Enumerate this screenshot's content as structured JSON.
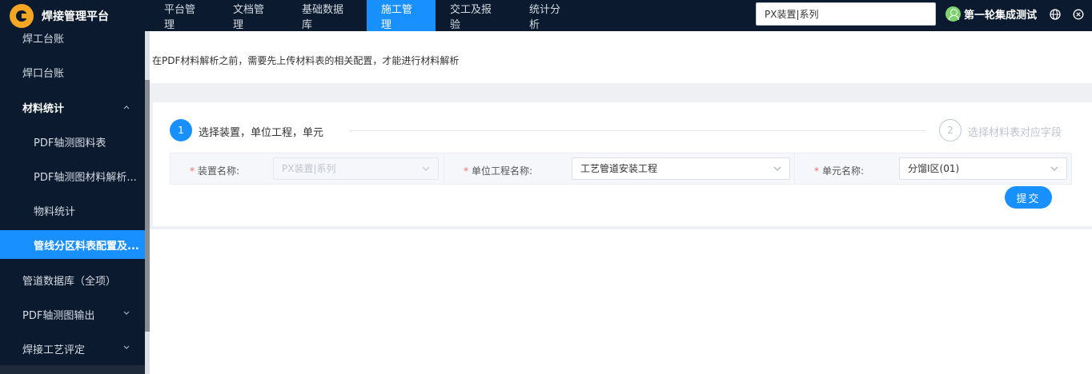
{
  "app": {
    "title": "焊接管理平台"
  },
  "nav": {
    "items": [
      {
        "label": "平台管理"
      },
      {
        "label": "文档管理"
      },
      {
        "label": "基础数据库"
      },
      {
        "label": "施工管理"
      },
      {
        "label": "交工及报验"
      },
      {
        "label": "统计分析"
      }
    ],
    "active_index": 3
  },
  "header": {
    "search_value": "PX装置|系列",
    "user_name": "第一轮集成测试",
    "icons": [
      "user-avatar-icon",
      "globe-icon",
      "logout-icon"
    ]
  },
  "sidebar": {
    "items": [
      {
        "label": "焊工台账"
      },
      {
        "label": "焊口台账"
      },
      {
        "label": "材料统计"
      },
      {
        "label": "PDF轴测图料表"
      },
      {
        "label": "PDF轴测图材料解析..."
      },
      {
        "label": "物料统计"
      },
      {
        "label": "管线分区料表配置及..."
      },
      {
        "label": "管道数据库（全项）"
      },
      {
        "label": "PDF轴测图输出"
      },
      {
        "label": "焊接工艺评定"
      }
    ],
    "active_index": 6
  },
  "main": {
    "notice": "在PDF材料解析之前，需要先上传材料表的相关配置，才能进行材料解析",
    "steps": [
      {
        "number": "1",
        "label": "选择装置，单位工程，单元",
        "status": "active"
      },
      {
        "number": "2",
        "label": "选择材料表对应字段",
        "status": "pending"
      }
    ],
    "form": {
      "device": {
        "label": "装置名称:",
        "value": "PX装置|系列",
        "disabled": true
      },
      "unit_project": {
        "label": "单位工程名称:",
        "value": "工艺管道安装工程"
      },
      "unit": {
        "label": "单元名称:",
        "value": "分馏Ⅰ区(01)"
      }
    },
    "submit_label": "提交"
  },
  "colors": {
    "primary": "#1890ff",
    "nav_bg": "#0b1a2e",
    "required": "#f56c6c",
    "logo": "#f5a623"
  }
}
